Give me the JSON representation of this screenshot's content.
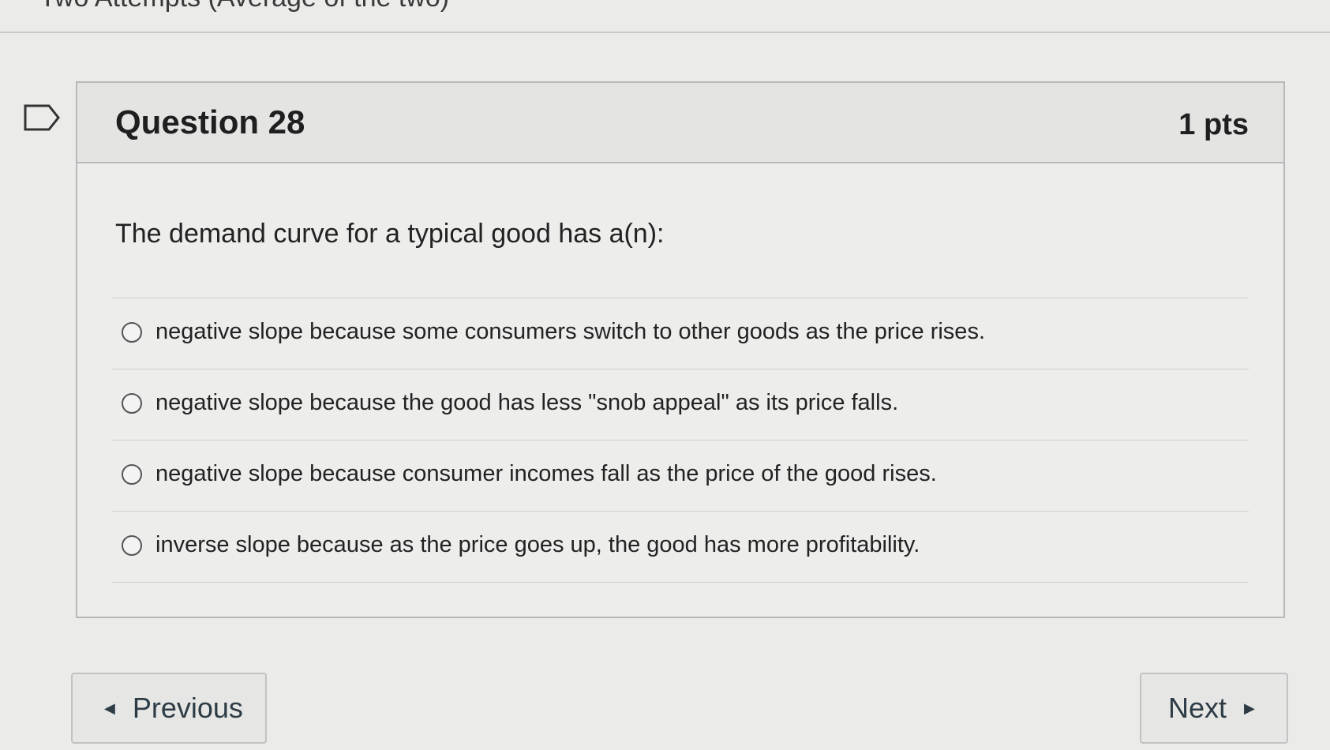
{
  "page": {
    "top_heading": "Two Attempts (Average of the two)"
  },
  "question": {
    "title": "Question 28",
    "points": "1 pts",
    "text": "The demand curve for a typical good has a(n):",
    "answers": [
      {
        "label": "negative slope because some consumers switch to other goods as the price rises.",
        "selected": false
      },
      {
        "label": "negative slope because the good has less \"snob appeal\" as its price falls.",
        "selected": false
      },
      {
        "label": "negative slope because consumer incomes fall as the price of the good rises.",
        "selected": false
      },
      {
        "label": "inverse slope because as the price goes up, the good has more profitability.",
        "selected": false
      }
    ]
  },
  "icons": {
    "flag": "flag-icon",
    "prev": "left-triangle-icon",
    "next": "right-triangle-icon"
  },
  "navigation": {
    "previous_label": "Previous",
    "next_label": "Next"
  },
  "colors": {
    "background": "#ebebea",
    "header": "#e4e4e3",
    "border": "#b9b9b9",
    "text": "#2d3b45"
  }
}
